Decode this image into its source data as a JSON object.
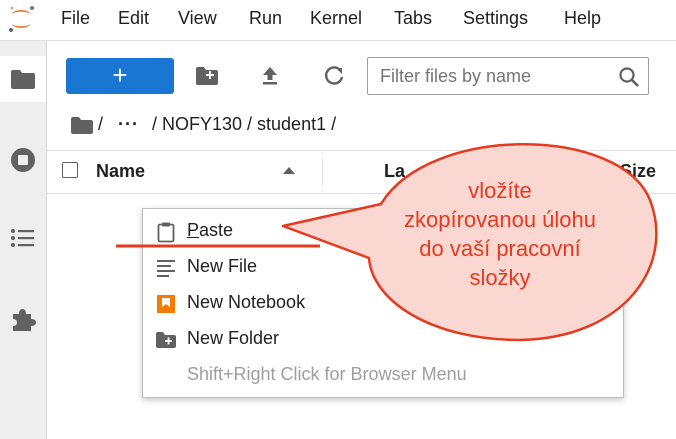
{
  "menu": {
    "items": [
      "File",
      "Edit",
      "View",
      "Run",
      "Kernel",
      "Tabs",
      "Settings",
      "Help"
    ]
  },
  "toolbar": {
    "new_label": "+",
    "filter_placeholder": "Filter files by name"
  },
  "breadcrumb": {
    "sep1": "/",
    "ellipsis": "···",
    "path": "/ NOFY130 / student1 /"
  },
  "file_list": {
    "col_name": "Name",
    "col_modified": "La",
    "col_size": "e Size"
  },
  "context_menu": {
    "items": [
      {
        "label_first": "P",
        "label_rest": "aste",
        "icon": "clipboard-icon",
        "enabled": true
      },
      {
        "label": "New File",
        "icon": "text-file-icon",
        "enabled": true
      },
      {
        "label": "New Notebook",
        "icon": "notebook-icon",
        "enabled": true
      },
      {
        "label": "New Folder",
        "icon": "new-folder-icon",
        "enabled": true
      },
      {
        "label": "Shift+Right Click for Browser Menu",
        "enabled": false
      }
    ]
  },
  "annotation": {
    "lines": [
      "vložíte",
      "zkopírovanou úlohu",
      "do vaší pracovní",
      "složky"
    ],
    "color": "#e53a1f"
  },
  "colors": {
    "accent": "#1976d2",
    "notebook_orange": "#f57c00",
    "sidebar_bg": "#eeeeee"
  }
}
